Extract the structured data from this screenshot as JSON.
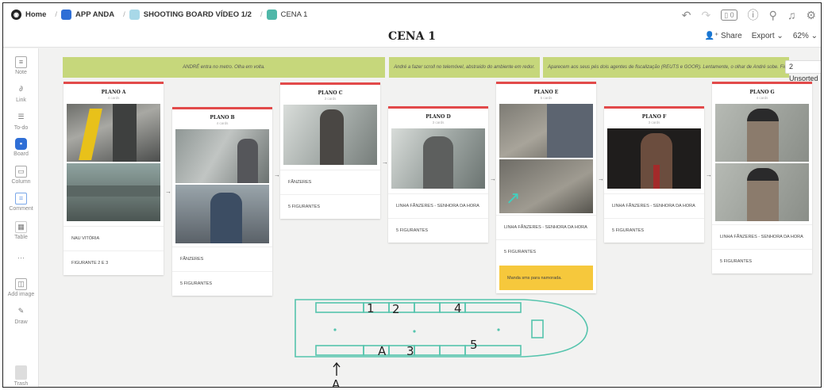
{
  "breadcrumb": {
    "home": "Home",
    "items": [
      {
        "label": "APP ANDA",
        "color": "#2f6fd6"
      },
      {
        "label": "SHOOTING BOARD VÍDEO 1/2",
        "color": "#a8d8e8"
      },
      {
        "label": "CENA 1",
        "color": "#4fb7a8"
      }
    ]
  },
  "topbar": {
    "notif_count": "0"
  },
  "page_title": "CENA 1",
  "toolbar": {
    "share": "Share",
    "export": "Export",
    "zoom": "62%"
  },
  "sidebar": {
    "tools": [
      {
        "label": "Note",
        "icon": "note-icon"
      },
      {
        "label": "Link",
        "icon": "link-icon"
      },
      {
        "label": "To-do",
        "icon": "todo-icon"
      },
      {
        "label": "Board",
        "icon": "board-icon",
        "accent": "#2f6fd6"
      },
      {
        "label": "Column",
        "icon": "column-icon"
      },
      {
        "label": "Comment",
        "icon": "comment-icon"
      },
      {
        "label": "Table",
        "icon": "table-icon"
      },
      {
        "label": "",
        "icon": "more-icon"
      },
      {
        "label": "Add image",
        "icon": "image-icon"
      },
      {
        "label": "Draw",
        "icon": "pencil-icon"
      },
      {
        "label": "Trash",
        "icon": "trash-icon"
      }
    ]
  },
  "banners": [
    "ANDRÉ entra no metro. Olha em volta.",
    "André a fazer scroll no telemóvel, abstraído do ambiente em redor.",
    "Aparecem aos seus pés dois agentes de fiscalização (REUTS e GOOR). Lentamente, o olhar de André sobe. Fica el"
  ],
  "unsorted": "2 Unsorted",
  "cards": [
    {
      "title": "PLANO A",
      "sub": "4 cards",
      "notes": [
        "NAU VITÓRIA",
        "FIGURANTE 2 E 3"
      ]
    },
    {
      "title": "PLANO B",
      "sub": "4 cards",
      "notes": [
        "FÃNZERES",
        "5 FIGURANTES"
      ]
    },
    {
      "title": "PLANO C",
      "sub": "3 cards",
      "notes": [
        "FÃNZERES",
        "5 FIGURANTES"
      ]
    },
    {
      "title": "PLANO D",
      "sub": "3 cards",
      "notes": [
        "LINHA FÃNZERES - SENHORA DA HORA",
        "5 FIGURANTES"
      ]
    },
    {
      "title": "PLANO E",
      "sub": "5 cards",
      "notes": [
        "LINHA FÃNZERES - SENHORA DA HORA",
        "5 FIGURANTES"
      ],
      "yellow_note": "Manda sms para namorada."
    },
    {
      "title": "PLANO F",
      "sub": "3 cards",
      "notes": [
        "LINHA FÃNZERES - SENHORA DA HORA",
        "5 FIGURANTES"
      ]
    },
    {
      "title": "PLANO G",
      "sub": "4 cards",
      "notes": [
        "LINHA FÃNZERES - SENHORA DA HORA",
        "5 FIGURANTES"
      ]
    }
  ],
  "sketch_labels": [
    "1",
    "2",
    "4",
    "A",
    "3",
    "5",
    "A"
  ]
}
